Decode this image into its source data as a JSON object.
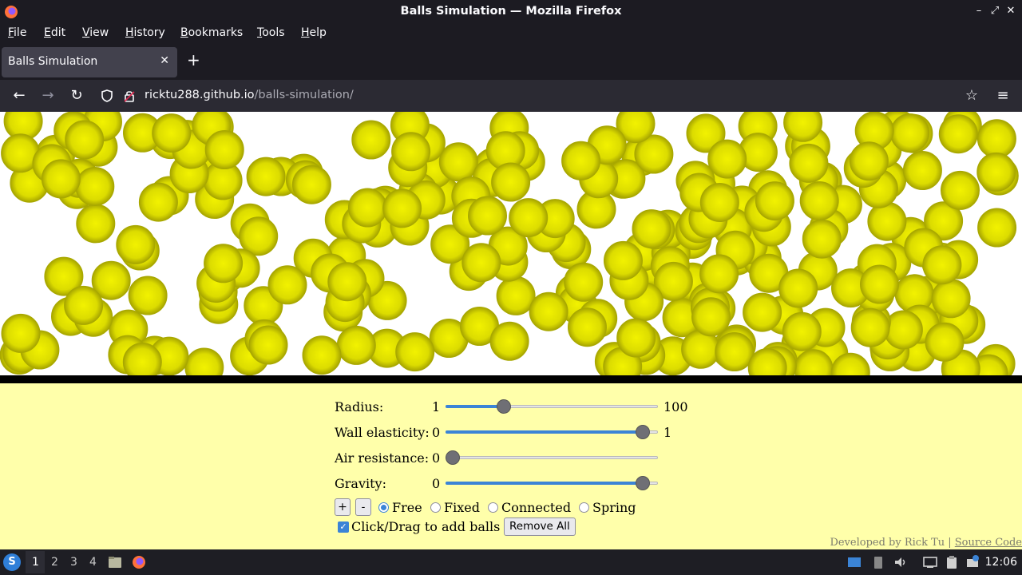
{
  "window": {
    "title": "Balls Simulation — Mozilla Firefox",
    "minimize_glyph": "–",
    "maximize_glyph": "⤢",
    "close_glyph": "✕"
  },
  "menubar": {
    "items": [
      {
        "label": "File",
        "accel": "F",
        "rest": "ile"
      },
      {
        "label": "Edit",
        "accel": "E",
        "rest": "dit"
      },
      {
        "label": "View",
        "accel": "V",
        "rest": "iew"
      },
      {
        "label": "History",
        "accel": "H",
        "rest": "istory"
      },
      {
        "label": "Bookmarks",
        "accel": "B",
        "rest": "ookmarks"
      },
      {
        "label": "Tools",
        "accel": "T",
        "rest": "ools"
      },
      {
        "label": "Help",
        "accel": "H",
        "rest": "elp"
      }
    ]
  },
  "tabs": {
    "active_title": "Balls Simulation",
    "close_glyph": "✕",
    "new_tab_glyph": "+"
  },
  "navbar": {
    "back_glyph": "←",
    "forward_glyph": "→",
    "reload_glyph": "↻",
    "url_host": "ricktu288.github.io",
    "url_path": "/balls-simulation/",
    "bookmark_glyph": "☆",
    "menu_glyph": "≡"
  },
  "simulation": {
    "ball_color": "#e0e000",
    "ball_edge": "#a8a800",
    "ball_count": 260,
    "ball_radius": 24
  },
  "controls": {
    "radius": {
      "label": "Radius:",
      "min": "1",
      "max": "100",
      "value_fraction": 0.26
    },
    "wall_elasticity": {
      "label": "Wall elasticity:",
      "min": "0",
      "max": "1",
      "value_fraction": 0.96
    },
    "air_resistance": {
      "label": "Air resistance:",
      "min": "0",
      "max": "",
      "value_fraction": 0.0
    },
    "gravity": {
      "label": "Gravity:",
      "min": "0",
      "max": "",
      "value_fraction": 0.96
    },
    "add_button": "+",
    "remove_button_small": "-",
    "modes": [
      {
        "label": "Free",
        "checked": true
      },
      {
        "label": "Fixed",
        "checked": false
      },
      {
        "label": "Connected",
        "checked": false
      },
      {
        "label": "Spring",
        "checked": false
      }
    ],
    "click_drag_label": "Click/Drag to add balls",
    "click_drag_checked": true,
    "checkmark": "✓",
    "remove_all": "Remove All"
  },
  "footer": {
    "developed_by": "Developed by Rick Tu | ",
    "source_code": "Source Code"
  },
  "taskbar": {
    "start_glyph": "S",
    "workspaces": [
      "1",
      "2",
      "3",
      "4"
    ],
    "active_workspace": "1",
    "clock": "12:06"
  }
}
